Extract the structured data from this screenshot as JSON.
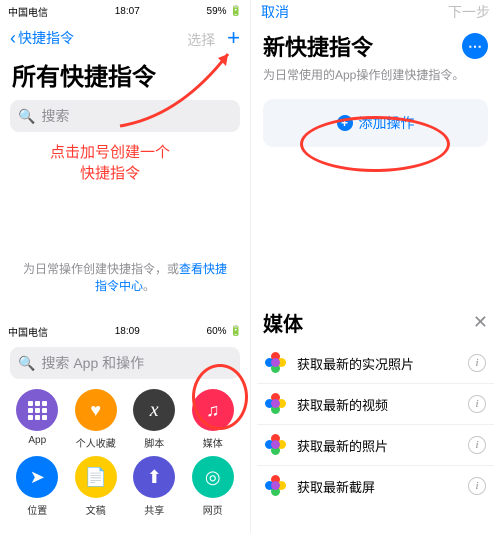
{
  "p1": {
    "status": {
      "carrier": "中国电信",
      "time": "18:07",
      "battery": "59%"
    },
    "nav": {
      "back": "快捷指令",
      "select": "选择"
    },
    "title": "所有快捷指令",
    "search_placeholder": "搜索",
    "hint_prefix": "为日常操作创建快捷指令，或",
    "hint_link": "查看快捷指令中心",
    "hint_suffix": "。"
  },
  "p2": {
    "nav": {
      "cancel": "取消",
      "next": "下一步"
    },
    "title": "新快捷指令",
    "subtitle": "为日常使用的App操作创建快捷指令。",
    "add_action": "添加操作"
  },
  "p3": {
    "status": {
      "carrier": "中国电信",
      "time": "18:09",
      "battery": "60%"
    },
    "search_placeholder": "搜索 App 和操作",
    "cats": [
      {
        "label": "App"
      },
      {
        "label": "个人收藏"
      },
      {
        "label": "脚本"
      },
      {
        "label": "媒体"
      },
      {
        "label": "位置"
      },
      {
        "label": "文稿"
      },
      {
        "label": "共享"
      },
      {
        "label": "网页"
      }
    ]
  },
  "p4": {
    "title": "媒体",
    "rows": [
      {
        "label": "获取最新的实况照片"
      },
      {
        "label": "获取最新的视频"
      },
      {
        "label": "获取最新的照片"
      },
      {
        "label": "获取最新截屏"
      }
    ]
  },
  "annotation": {
    "line1": "点击加号创建一个",
    "line2": "快捷指令"
  }
}
